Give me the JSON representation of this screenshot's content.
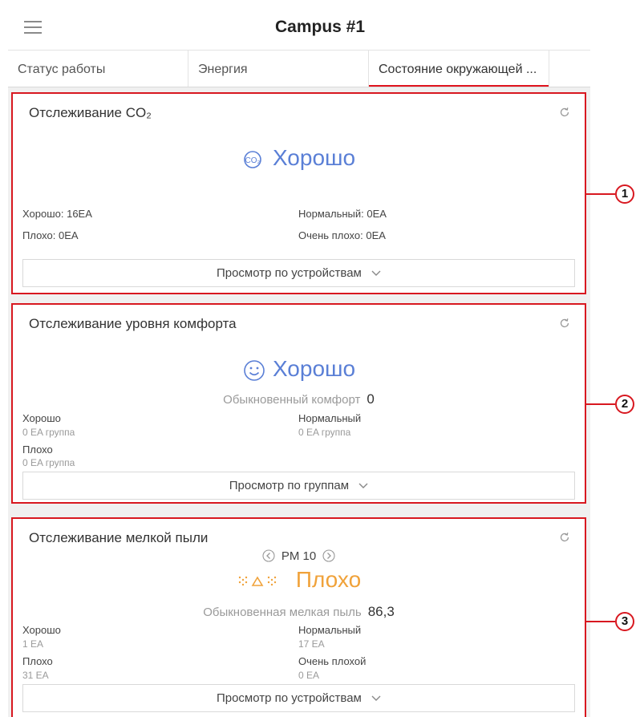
{
  "app": {
    "title": "Campus #1"
  },
  "tabs": [
    {
      "label": "Статус работы",
      "active": false
    },
    {
      "label": "Энергия",
      "active": false
    },
    {
      "label": "Состояние окружающей ...",
      "active": true
    }
  ],
  "co2": {
    "title": "Отслеживание CO₂",
    "icon_text": "CO₂",
    "status": "Хорошо",
    "good": "Хорошо: 16EA",
    "normal": "Нормальный: 0EA",
    "bad": "Плохо: 0EA",
    "very_bad": "Очень плохо: 0EA",
    "button": "Просмотр по устройствам",
    "callout": "1"
  },
  "comfort": {
    "title": "Отслеживание уровня комфорта",
    "status": "Хорошо",
    "summary_label": "Обыкновенный комфорт",
    "summary_value": "0",
    "good_label": "Хорошо",
    "good_value": "0 EA группа",
    "normal_label": "Нормальный",
    "normal_value": "0 EA группа",
    "bad_label": "Плохо",
    "bad_value": "0 EA группа",
    "button": "Просмотр по группам",
    "callout": "2"
  },
  "dust": {
    "title": "Отслеживание мелкой пыли",
    "pm_label": "PM 10",
    "status": "Плохо",
    "summary_label": "Обыкновенная мелкая пыль",
    "summary_value": "86,3",
    "good_label": "Хорошо",
    "good_value": "1 EA",
    "normal_label": "Нормальный",
    "normal_value": "17 EA",
    "bad_label": "Плохо",
    "bad_value": "31 EA",
    "very_bad_label": "Очень плохой",
    "very_bad_value": "0 EA",
    "button": "Просмотр по устройствам",
    "callout": "3"
  },
  "colors": {
    "accent_red": "#d81820",
    "status_good": "#5a7fd6",
    "status_bad": "#f0a23a"
  }
}
